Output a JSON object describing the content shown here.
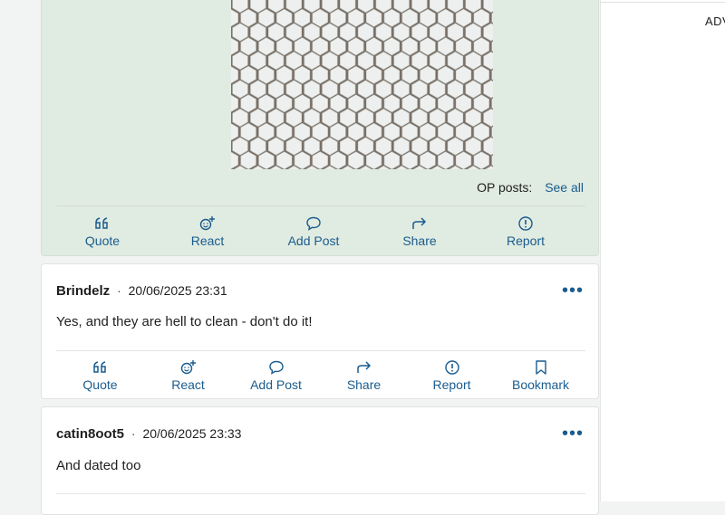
{
  "ad": {
    "label": "ADV"
  },
  "op": {
    "op_posts_label": "OP posts:",
    "see_all_label": "See all",
    "actions": [
      {
        "label": "Quote",
        "icon": "quote-icon"
      },
      {
        "label": "React",
        "icon": "react-icon"
      },
      {
        "label": "Add Post",
        "icon": "comment-icon"
      },
      {
        "label": "Share",
        "icon": "share-icon"
      },
      {
        "label": "Report",
        "icon": "report-icon"
      }
    ]
  },
  "posts": [
    {
      "username": "Brindelz",
      "separator": "·",
      "timestamp": "20/06/2025 23:31",
      "text": "Yes, and they are hell to clean - don't do it!",
      "more": "•••",
      "actions": [
        {
          "label": "Quote",
          "icon": "quote-icon"
        },
        {
          "label": "React",
          "icon": "react-icon"
        },
        {
          "label": "Add Post",
          "icon": "comment-icon"
        },
        {
          "label": "Share",
          "icon": "share-icon"
        },
        {
          "label": "Report",
          "icon": "report-icon"
        },
        {
          "label": "Bookmark",
          "icon": "bookmark-icon"
        }
      ]
    },
    {
      "username": "catin8oot5",
      "separator": "·",
      "timestamp": "20/06/2025 23:33",
      "text": "And dated too",
      "more": "•••"
    }
  ],
  "colors": {
    "accent": "#1a5c8e",
    "op_background": "#e0ebe1",
    "page_background": "#f2f3f3"
  }
}
